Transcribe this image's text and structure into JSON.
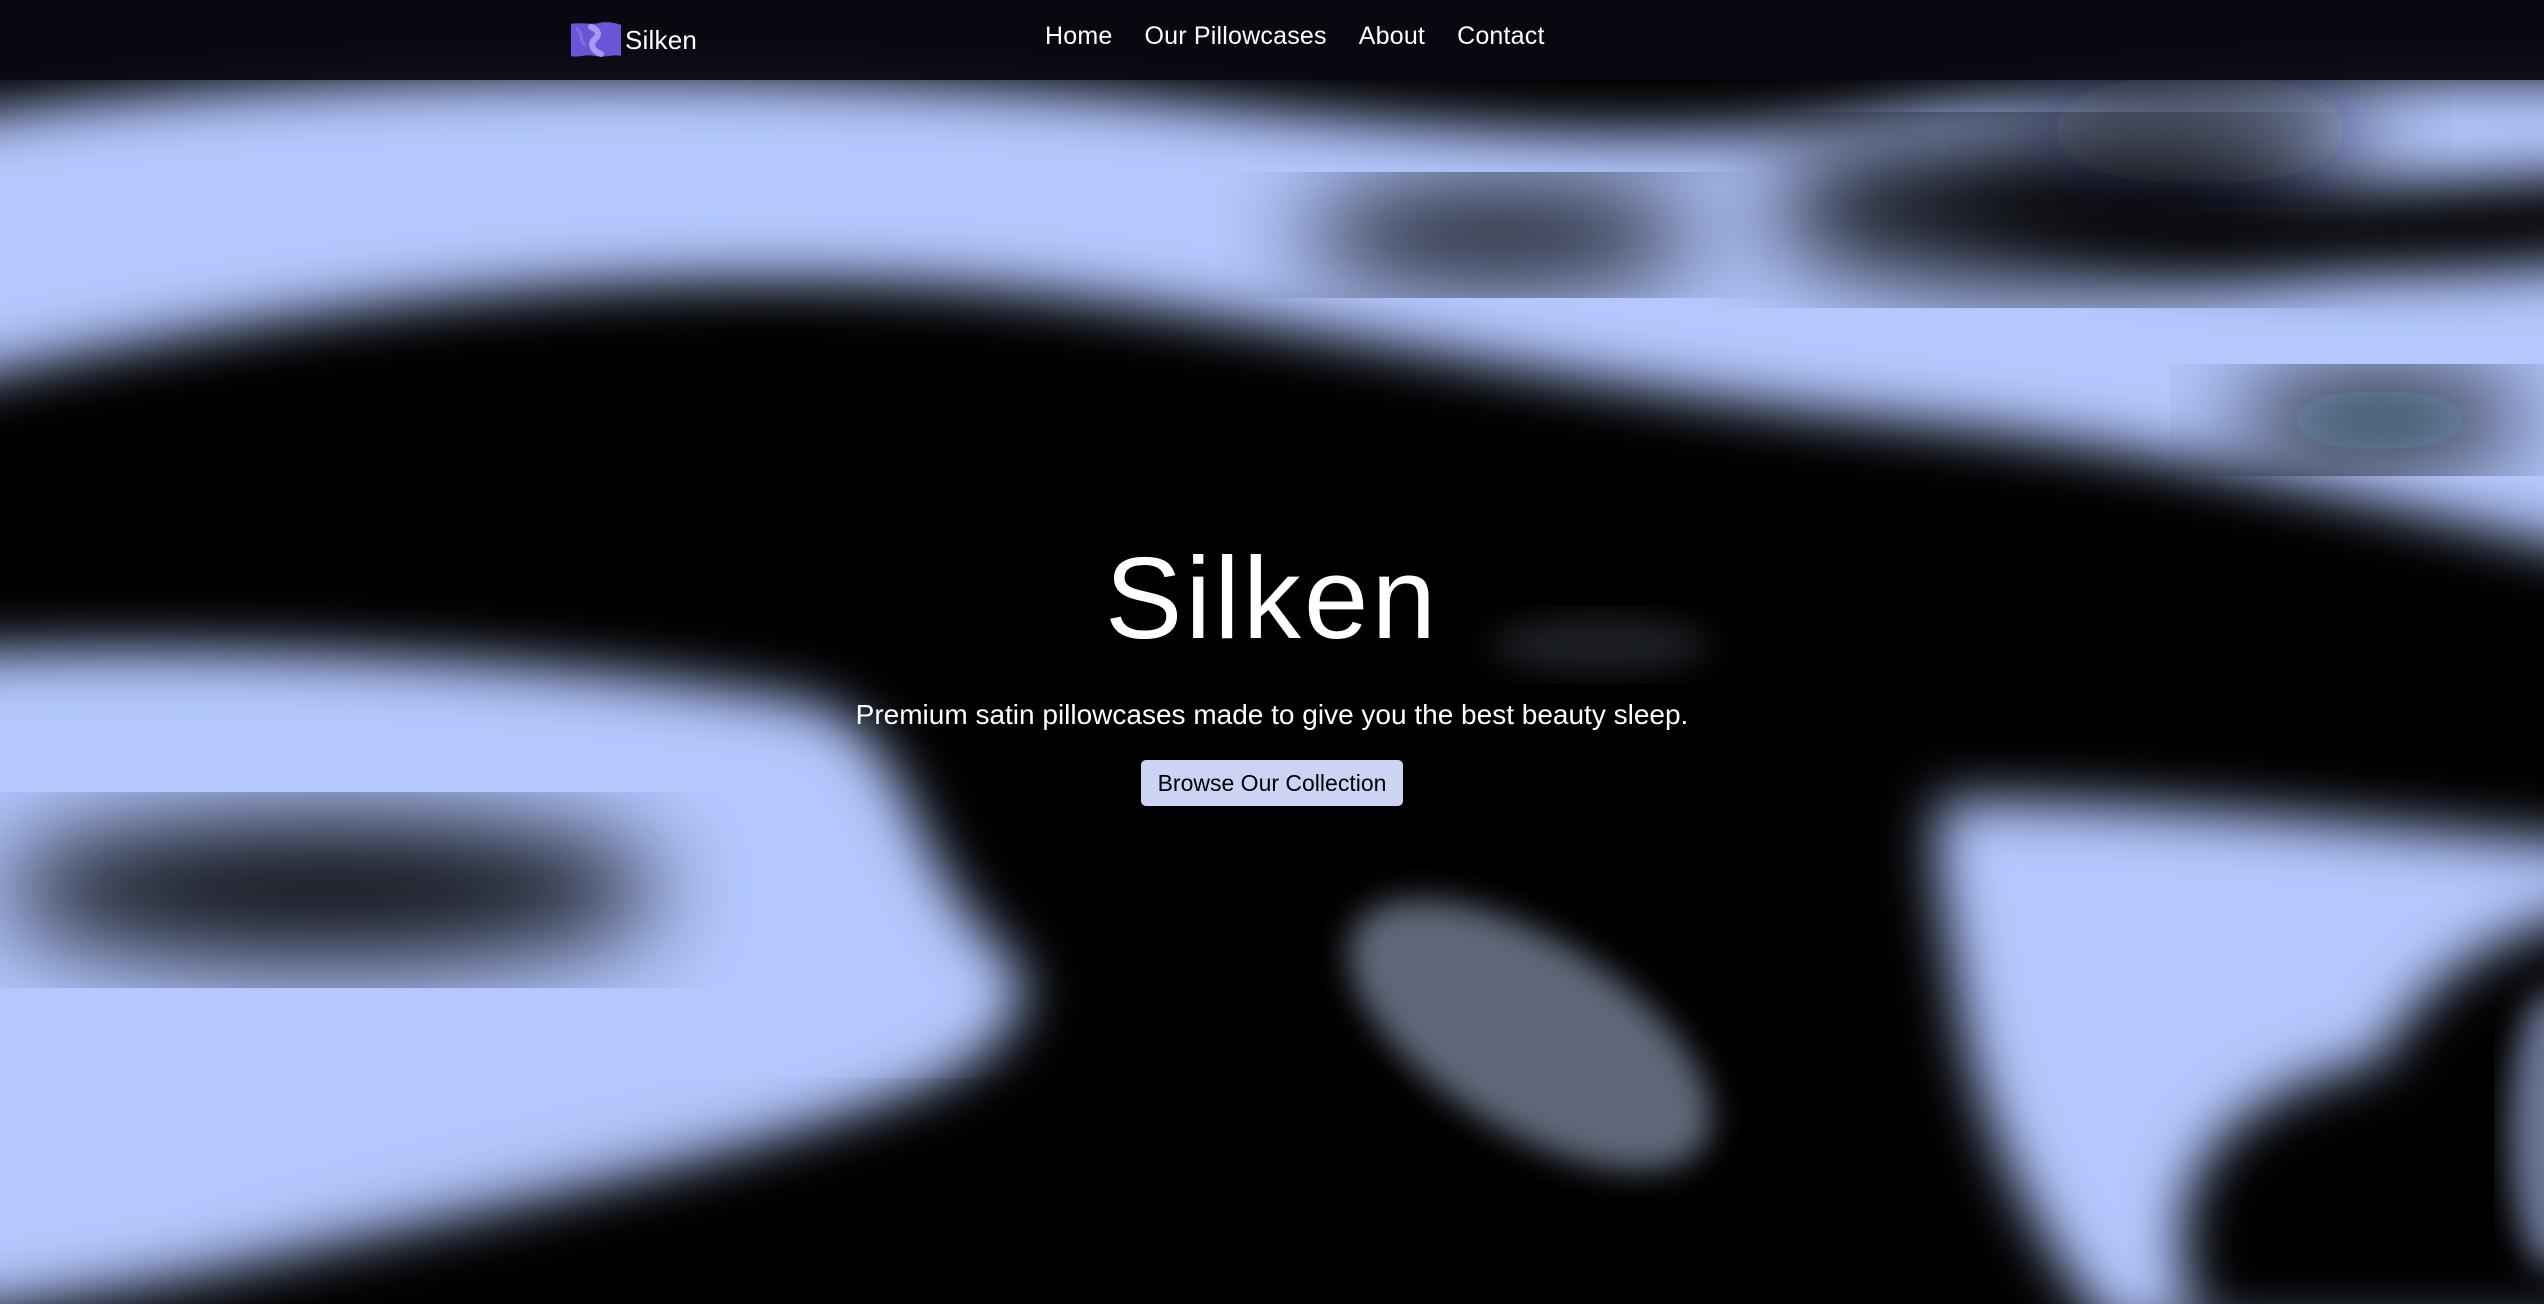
{
  "brand": {
    "name": "Silken",
    "logo_icon": "wavy-pillow-logo",
    "logo_colors": [
      "#6b55d6",
      "#a99af0"
    ]
  },
  "nav": {
    "items": [
      {
        "label": "Home"
      },
      {
        "label": "Our Pillowcases"
      },
      {
        "label": "About"
      },
      {
        "label": "Contact"
      }
    ]
  },
  "hero": {
    "title": "Silken",
    "subtitle": "Premium satin pillowcases made to give you the best beauty sleep.",
    "cta_label": "Browse Our Collection"
  },
  "colors": {
    "navbar_bg": "#0a0912",
    "silk_highlight": "#b4c8ff",
    "page_bg": "#000000",
    "cta_bg": "#cdd3f2"
  }
}
